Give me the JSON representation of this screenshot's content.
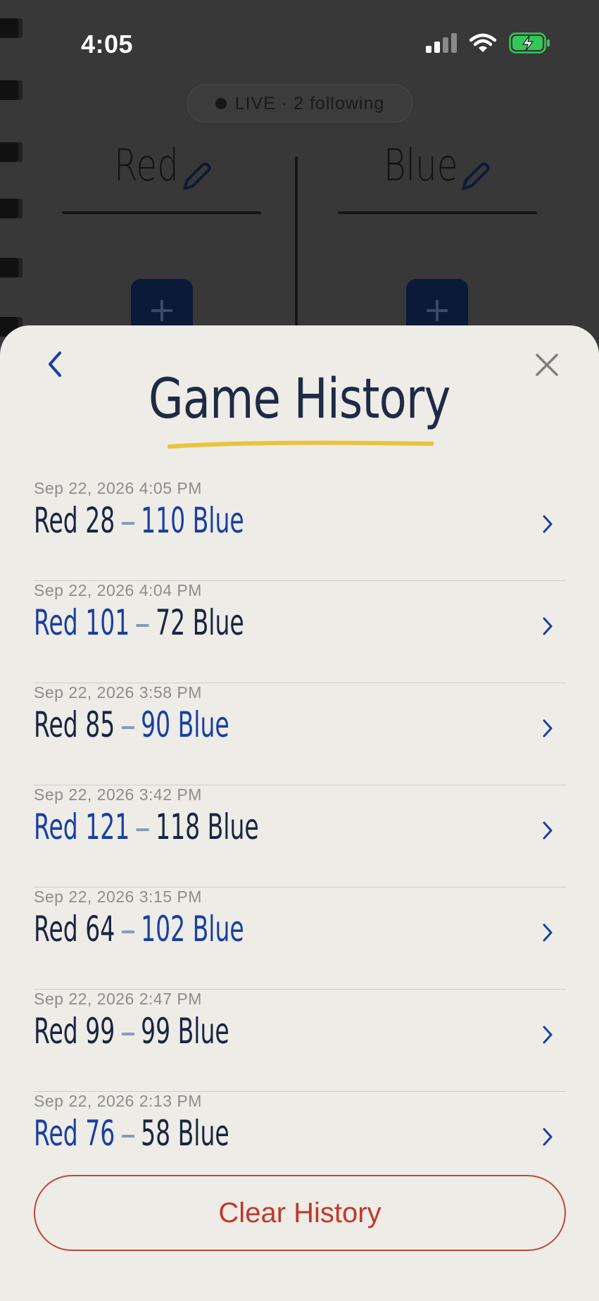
{
  "status_bar": {
    "time": "4:05"
  },
  "background": {
    "live_label": "LIVE · 2 following",
    "team_left": "Red",
    "team_right": "Blue",
    "plus_symbol": "+"
  },
  "sheet": {
    "title": "Game History",
    "clear_label": "Clear History",
    "games": [
      {
        "date": "Sep 22, 2026  4:05 PM",
        "left_team": "Red",
        "left_score": "28",
        "right_score": "110",
        "right_team": "Blue",
        "winner": "right"
      },
      {
        "date": "Sep 22, 2026  4:04 PM",
        "left_team": "Red",
        "left_score": "101",
        "right_score": "72",
        "right_team": "Blue",
        "winner": "left"
      },
      {
        "date": "Sep 22, 2026  3:58 PM",
        "left_team": "Red",
        "left_score": "85",
        "right_score": "90",
        "right_team": "Blue",
        "winner": "right"
      },
      {
        "date": "Sep 22, 2026  3:42 PM",
        "left_team": "Red",
        "left_score": "121",
        "right_score": "118",
        "right_team": "Blue",
        "winner": "left"
      },
      {
        "date": "Sep 22, 2026  3:15 PM",
        "left_team": "Red",
        "left_score": "64",
        "right_score": "102",
        "right_team": "Blue",
        "winner": "right"
      },
      {
        "date": "Sep 22, 2026  2:47 PM",
        "left_team": "Red",
        "left_score": "99",
        "right_score": "99",
        "right_team": "Blue",
        "winner": "tie"
      },
      {
        "date": "Sep 22, 2026  2:13 PM",
        "left_team": "Red",
        "left_score": "76",
        "right_score": "58",
        "right_team": "Blue",
        "winner": "left"
      }
    ]
  },
  "colors": {
    "accent_blue": "#1a3fa0",
    "ink_dark": "#1a2540",
    "destructive": "#c0392b",
    "highlight_yellow": "#e8c43c",
    "battery_green": "#34c759"
  },
  "icons": {
    "back": "chevron-left-icon",
    "close": "close-icon",
    "row_chevron": "chevron-right-icon",
    "edit": "pencil-icon"
  }
}
